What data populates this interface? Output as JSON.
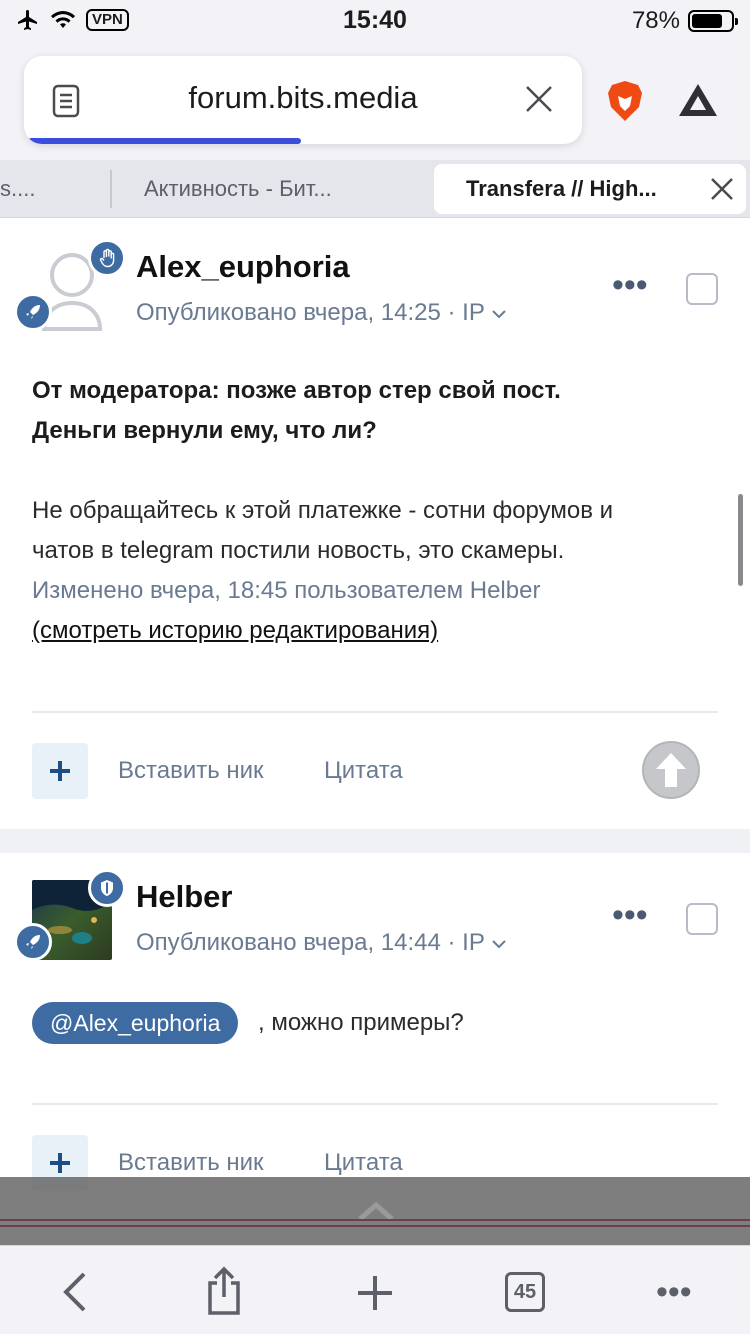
{
  "status_bar": {
    "time": "15:40",
    "vpn": "VPN",
    "battery": "78%",
    "battery_level": 0.78
  },
  "browser": {
    "url": "forum.bits.media",
    "load_progress": 0.49,
    "tabs": [
      {
        "label": "s...."
      },
      {
        "label": "Активность - Бит..."
      },
      {
        "label": "Transfera // High...",
        "active": true
      }
    ],
    "tab_count": "45"
  },
  "posts": [
    {
      "author": "Alex_euphoria",
      "meta": "Опубликовано вчера, 14:25 · IP",
      "moderator_note_line1": "От модератора: позже автор стер свой пост.",
      "moderator_note_line2": "Деньги вернули ему, что ли?",
      "body_line1": "Не обращайтесь к этой платежке - сотни форумов и",
      "body_line2": "чатов в telegram постили новость, это скамеры.",
      "edited": "Изменено вчера, 18:45 пользователем Helber",
      "history_link": "(смотреть историю редактирования)",
      "insert_nick": "Вставить ник",
      "quote": "Цитата"
    },
    {
      "author": "Helber",
      "meta": "Опубликовано вчера, 14:44 · IP",
      "mention": "@Alex_euphoria",
      "text": ", можно примеры?",
      "insert_nick": "Вставить ник",
      "quote": "Цитата"
    }
  ],
  "icons": {
    "reader": "reader-mode-icon",
    "clear": "close-icon",
    "brave": "brave-lion-icon",
    "bat": "bat-triangle-icon"
  }
}
